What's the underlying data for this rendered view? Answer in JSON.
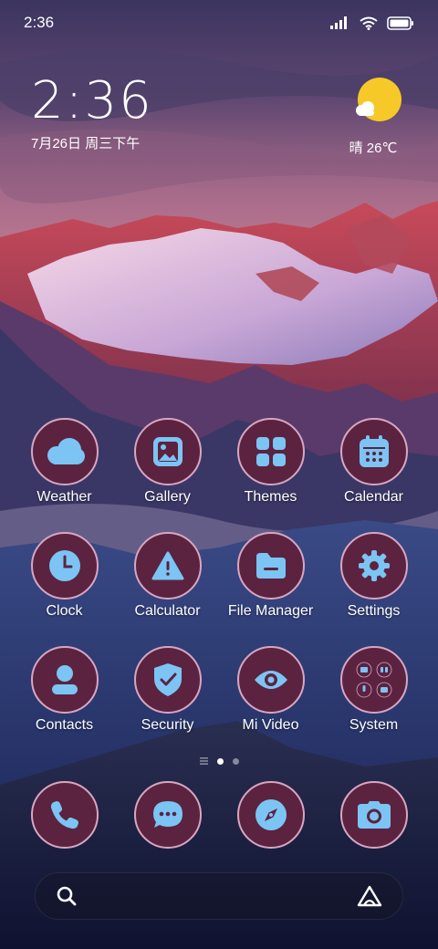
{
  "status_bar": {
    "time": "2:36"
  },
  "clock_widget": {
    "time": "2:36",
    "date": "7月26日 周三下午"
  },
  "weather_widget": {
    "condition_temp": "晴 26℃"
  },
  "colors": {
    "icon_bg": "#5b2340",
    "icon_border": "#d8a6c2",
    "glyph": "#7cc4f4",
    "sun": "#f7c928"
  },
  "apps": [
    {
      "label": "Weather",
      "icon": "cloud-icon"
    },
    {
      "label": "Gallery",
      "icon": "image-icon"
    },
    {
      "label": "Themes",
      "icon": "grid-icon"
    },
    {
      "label": "Calendar",
      "icon": "calendar-icon"
    },
    {
      "label": "Clock",
      "icon": "clock-icon"
    },
    {
      "label": "Calculator",
      "icon": "warning-icon"
    },
    {
      "label": "File Manager",
      "icon": "folder-icon"
    },
    {
      "label": "Settings",
      "icon": "gear-icon"
    },
    {
      "label": "Contacts",
      "icon": "person-icon"
    },
    {
      "label": "Security",
      "icon": "shield-check-icon"
    },
    {
      "label": "Mi Video",
      "icon": "eye-icon"
    },
    {
      "label": "System",
      "icon": "folder-grid-icon"
    }
  ],
  "page_indicator": {
    "pages": 2,
    "current": 1
  },
  "dock": [
    {
      "name": "phone",
      "icon": "phone-icon"
    },
    {
      "name": "messages",
      "icon": "chat-icon"
    },
    {
      "name": "browser",
      "icon": "compass-icon"
    },
    {
      "name": "camera",
      "icon": "camera-icon"
    }
  ],
  "search": {
    "left_icon": "search-icon",
    "right_icon": "assistant-icon"
  }
}
